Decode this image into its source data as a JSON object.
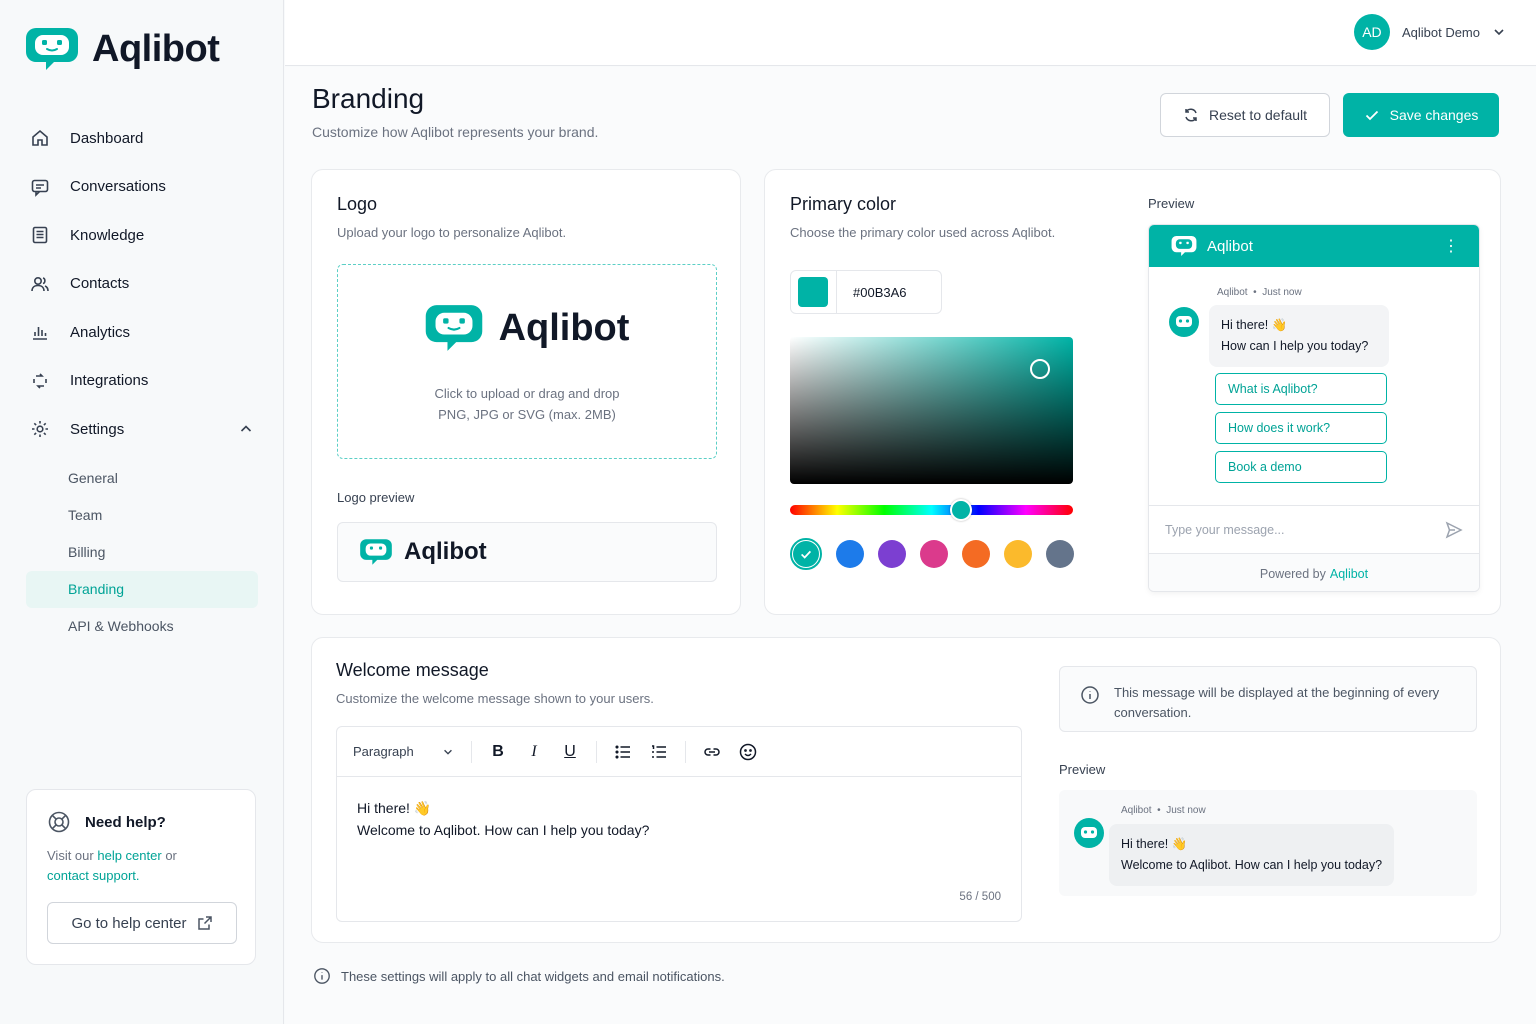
{
  "brand": {
    "name": "Aqlibot",
    "accent": "#00B3A6"
  },
  "sidebar": {
    "items": [
      {
        "label": "Dashboard",
        "icon": "home-icon"
      },
      {
        "label": "Conversations",
        "icon": "chat-icon"
      },
      {
        "label": "Knowledge",
        "icon": "book-icon"
      },
      {
        "label": "Contacts",
        "icon": "users-icon"
      },
      {
        "label": "Analytics",
        "icon": "bar-chart-icon"
      },
      {
        "label": "Integrations",
        "icon": "integrations-icon"
      },
      {
        "label": "Settings",
        "icon": "gear-icon"
      }
    ],
    "settings_sub": [
      "General",
      "Team",
      "Billing",
      "Branding",
      "API & Webhooks"
    ],
    "active_sub": "Branding"
  },
  "help": {
    "title": "Need help?",
    "text_prefix": "Visit our",
    "link1": "help center",
    "text_mid": "or",
    "link2": "contact support.",
    "button": "Go to help center"
  },
  "user": {
    "initials": "AD",
    "name": "Aqlibot Demo"
  },
  "page": {
    "title": "Branding",
    "subtitle": "Customize how Aqlibot represents your brand.",
    "reset_label": "Reset to default",
    "save_label": "Save changes"
  },
  "logo_card": {
    "title": "Logo",
    "desc": "Upload your logo to personalize Aqlibot.",
    "upload_line1": "Click to upload or drag and drop",
    "upload_line2": "PNG, JPG or SVG (max. 2MB)",
    "preview_label": "Logo preview"
  },
  "color_card": {
    "title": "Primary color",
    "desc": "Choose the primary color used across Aqlibot.",
    "hex": "#00B3A6",
    "swatches": [
      "#00B3A6",
      "#1d7bea",
      "#7c3fd1",
      "#db3a8c",
      "#f46b23",
      "#fbba2c",
      "#64748b"
    ],
    "preview_label": "Preview"
  },
  "widget": {
    "title": "Aqlibot",
    "sender": "Aqlibot",
    "time": "Just now",
    "greeting": "Hi there! 👋",
    "question": "How can I help you today?",
    "quick_replies": [
      "What is Aqlibot?",
      "How does it work?",
      "Book a demo"
    ],
    "input_placeholder": "Type your message...",
    "powered_prefix": "Powered by",
    "powered_brand": "Aqlibot"
  },
  "welcome": {
    "title": "Welcome message",
    "desc": "Customize the welcome message shown to your users.",
    "format": "Paragraph",
    "line1": "Hi there! 👋",
    "line2": "Welcome to Aqlibot. How can I help you today?",
    "counter": "56 / 500",
    "info": "This message will be displayed at the beginning of every conversation.",
    "preview_label": "Preview"
  },
  "footer_note": "These settings will apply to all chat widgets and email notifications."
}
